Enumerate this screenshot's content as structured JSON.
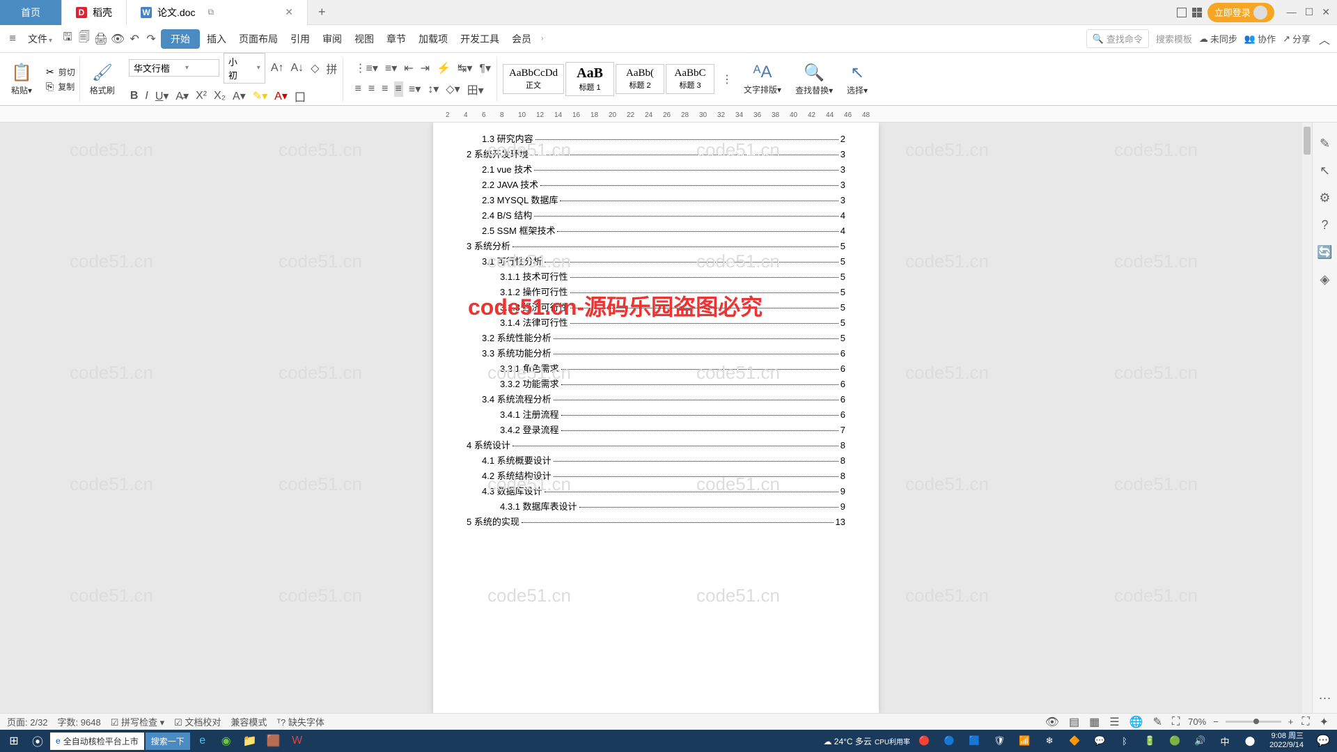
{
  "tabs": {
    "home": "首页",
    "docell": "稻壳",
    "doc": "论文.doc",
    "plus": "+"
  },
  "titlebar": {
    "login": "立即登录"
  },
  "menubar": {
    "file": "文件",
    "items": [
      "开始",
      "插入",
      "页面布局",
      "引用",
      "审阅",
      "视图",
      "章节",
      "加载项",
      "开发工具",
      "会员"
    ],
    "search_cmd": "查找命令",
    "search_tpl": "搜索模板",
    "unsync": "未同步",
    "collab": "协作",
    "share": "分享"
  },
  "ribbon": {
    "paste": "粘贴",
    "cut": "剪切",
    "copy": "复制",
    "fmt": "格式刷",
    "font": "华文行楷",
    "size": "小初",
    "styles": [
      {
        "prev": "AaBbCcDd",
        "name": "正文"
      },
      {
        "prev": "AaB",
        "name": "标题 1"
      },
      {
        "prev": "AaBb(",
        "name": "标题 2"
      },
      {
        "prev": "AaBbC",
        "name": "标题 3"
      }
    ],
    "text_layout": "文字排版",
    "find_replace": "查找替换",
    "select": "选择"
  },
  "ruler": [
    "2",
    "4",
    "6",
    "8",
    "10",
    "12",
    "14",
    "16",
    "18",
    "20",
    "22",
    "24",
    "26",
    "28",
    "30",
    "32",
    "34",
    "36",
    "38",
    "40",
    "42",
    "44",
    "46",
    "48"
  ],
  "toc": [
    {
      "lv": 2,
      "t": "1.3 研究内容",
      "p": "2"
    },
    {
      "lv": 1,
      "t": "2 系统开发环境",
      "p": "3"
    },
    {
      "lv": 2,
      "t": "2.1 vue 技术",
      "p": "3"
    },
    {
      "lv": 2,
      "t": "2.2 JAVA 技术",
      "p": "3"
    },
    {
      "lv": 2,
      "t": "2.3 MYSQL 数据库",
      "p": "3"
    },
    {
      "lv": 2,
      "t": "2.4 B/S 结构",
      "p": "4"
    },
    {
      "lv": 2,
      "t": "2.5 SSM 框架技术",
      "p": "4"
    },
    {
      "lv": 1,
      "t": "3 系统分析",
      "p": "5"
    },
    {
      "lv": 2,
      "t": "3.1 可行性分析",
      "p": "5"
    },
    {
      "lv": 3,
      "t": "3.1.1 技术可行性",
      "p": "5"
    },
    {
      "lv": 3,
      "t": "3.1.2 操作可行性",
      "p": "5"
    },
    {
      "lv": 3,
      "t": "3.1.3 经济可行性",
      "p": "5"
    },
    {
      "lv": 3,
      "t": "3.1.4 法律可行性",
      "p": "5"
    },
    {
      "lv": 2,
      "t": "3.2 系统性能分析",
      "p": "5"
    },
    {
      "lv": 2,
      "t": "3.3 系统功能分析",
      "p": "6"
    },
    {
      "lv": 3,
      "t": "3.3.1 角色需求",
      "p": "6"
    },
    {
      "lv": 3,
      "t": "3.3.2 功能需求",
      "p": "6"
    },
    {
      "lv": 2,
      "t": "3.4 系统流程分析",
      "p": "6"
    },
    {
      "lv": 3,
      "t": "3.4.1 注册流程",
      "p": "6"
    },
    {
      "lv": 3,
      "t": "3.4.2 登录流程",
      "p": "7"
    },
    {
      "lv": 1,
      "t": "4 系统设计",
      "p": "8"
    },
    {
      "lv": 2,
      "t": "4.1 系统概要设计",
      "p": "8"
    },
    {
      "lv": 2,
      "t": "4.2 系统结构设计",
      "p": "8"
    },
    {
      "lv": 2,
      "t": "4.3 数据库设计",
      "p": "9"
    },
    {
      "lv": 3,
      "t": "4.3.1 数据库表设计",
      "p": "9"
    },
    {
      "lv": 1,
      "t": "5 系统的实现",
      "p": "13"
    }
  ],
  "overlay": "code51.cn-源码乐园盗图必究",
  "wm": "code51.cn",
  "statusbar": {
    "page": "页面: 2/32",
    "words": "字数: 9648",
    "spell": "拼写检查",
    "proof": "文档校对",
    "compat": "兼容模式",
    "missfont": "缺失字体",
    "zoom": "70%",
    "cpu": "CPU利用率"
  },
  "taskbar": {
    "search_hint": "全自动核检平台上市",
    "search_btn": "搜索一下",
    "weather": "24°C 多云",
    "time": "9:08 周三",
    "date": "2022/9/14"
  }
}
